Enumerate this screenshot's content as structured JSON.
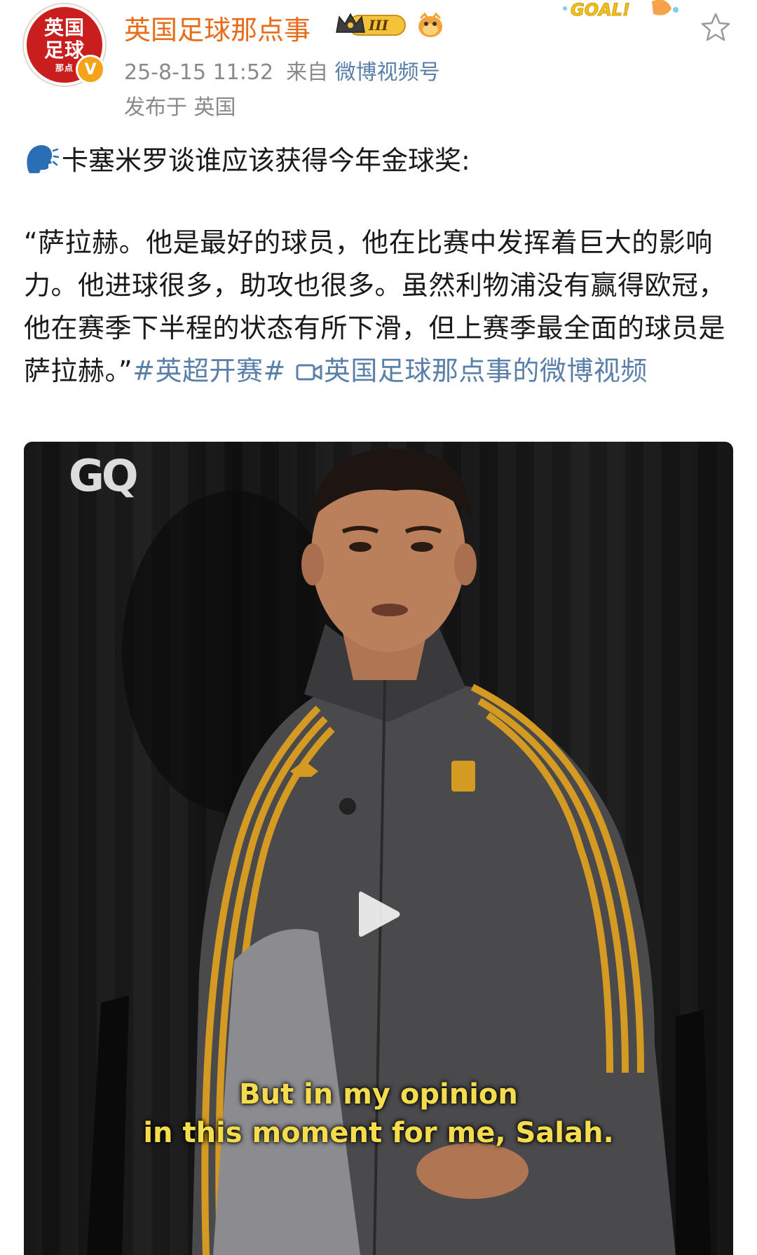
{
  "account": {
    "avatar_text_line1": "英国",
    "avatar_text_line2": "足球",
    "avatar_text_sub": "那点",
    "verified_mark": "V",
    "username": "英国足球那点事",
    "rank_badge": "III"
  },
  "sticker": {
    "text": "GOAL!"
  },
  "meta": {
    "datetime": "25-8-15 11:52",
    "source_prefix": "来自",
    "source": "微博视频号",
    "location": "发布于 英国"
  },
  "post": {
    "intro": "卡塞米罗谈谁应该获得今年金球奖:",
    "quote": "“萨拉赫。他是最好的球员，他在比赛中发挥着巨大的影响力。他进球很多，助攻也很多。虽然利物浦没有赢得欧冠，他在赛季下半程的状态有所下滑，但上赛季最全面的球员是萨拉赫。”",
    "hashtag": "#英超开赛#",
    "video_link": "英国足球那点事的微博视频"
  },
  "video": {
    "watermark": "GQ",
    "subtitle_line1": "But in my opinion",
    "subtitle_line2": "in this moment for me, Salah."
  },
  "colors": {
    "username": "#e86b1a",
    "link": "#5a7fa8",
    "meta": "#8a8a8a",
    "subtitle": "#f4dc4c",
    "avatar_bg": "#c81e1e",
    "verified": "#f7a21b"
  },
  "icons": [
    "speaking-head-icon",
    "video-camera-icon",
    "play-icon",
    "star-icon",
    "crown-icon",
    "mascot-icon",
    "verified-icon"
  ]
}
